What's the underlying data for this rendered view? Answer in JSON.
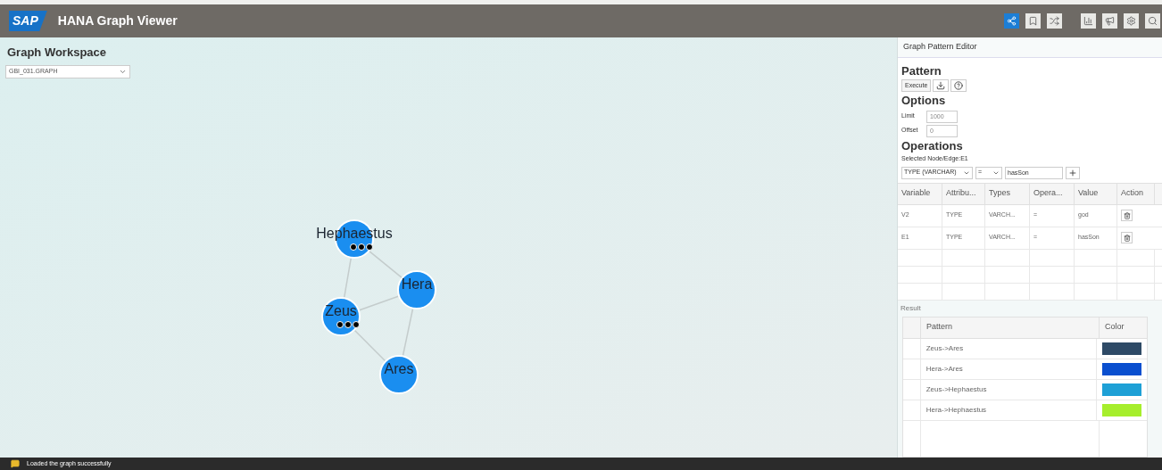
{
  "header": {
    "logo": "SAP",
    "title": "HANA Graph Viewer"
  },
  "toolbar": [
    {
      "selected": true
    },
    {
      "selected": false
    },
    {
      "selected": false
    },
    {
      "selected": false
    },
    {
      "selected": false
    },
    {
      "selected": false
    },
    {
      "selected": false
    }
  ],
  "workspace": {
    "title": "Graph Workspace",
    "graph_select": "GBI_031.GRAPH"
  },
  "graph": {
    "nodes": [
      {
        "label": "Hephaestus",
        "more": true
      },
      {
        "label": "Hera",
        "more": false
      },
      {
        "label": "Zeus",
        "more": true
      },
      {
        "label": "Ares",
        "more": false
      }
    ]
  },
  "editor": {
    "title": "Graph Pattern Editor",
    "pattern_heading": "Pattern",
    "execute_button": "Execute",
    "options_heading": "Options",
    "limit_label": "Limit",
    "limit_value": "1000",
    "offset_label": "Offset",
    "offset_value": "0",
    "operations_heading": "Operations",
    "selected_label": "Selected Node/Edge:E1",
    "attribute_select": "TYPE (VARCHAR)",
    "operator_select": "=",
    "value_field": "hasSon",
    "columns": [
      "Variable",
      "Attribu...",
      "Types",
      "Opera...",
      "Value",
      "Action"
    ],
    "rows": [
      [
        "V2",
        "TYPE",
        "VARCH...",
        "=",
        "god"
      ],
      [
        "E1",
        "TYPE",
        "VARCH...",
        "=",
        "hasSon"
      ]
    ],
    "result_label": "Result",
    "result_columns": [
      "Pattern",
      "Color"
    ],
    "results": [
      {
        "pattern": "Zeus->Ares",
        "color": "#2e4a66"
      },
      {
        "pattern": "Hera->Ares",
        "color": "#0a4fcf"
      },
      {
        "pattern": "Zeus->Hephaestus",
        "color": "#1ea0d6"
      },
      {
        "pattern": "Hera->Hephaestus",
        "color": "#a6ee2c"
      }
    ]
  },
  "status": {
    "message": "Loaded the graph successfully"
  }
}
